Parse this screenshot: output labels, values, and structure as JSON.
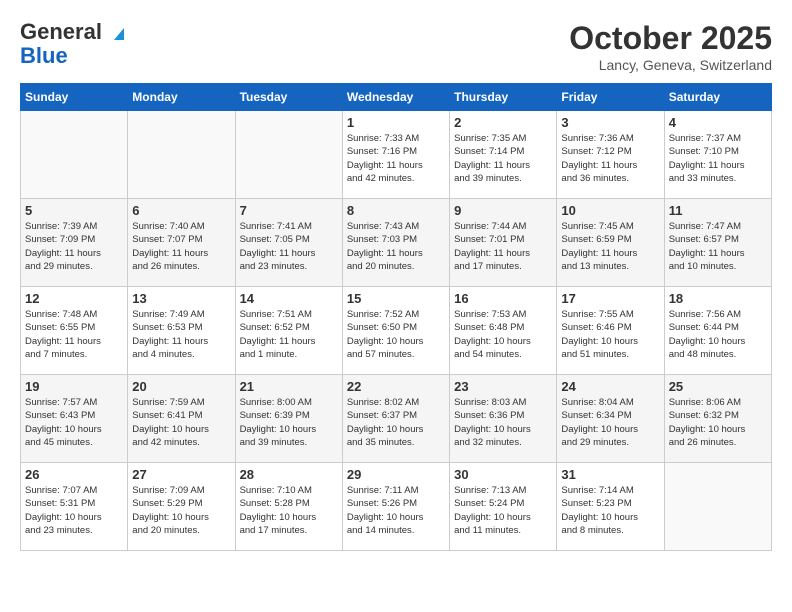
{
  "header": {
    "logo_line1": "General",
    "logo_line2": "Blue",
    "month": "October 2025",
    "location": "Lancy, Geneva, Switzerland"
  },
  "weekdays": [
    "Sunday",
    "Monday",
    "Tuesday",
    "Wednesday",
    "Thursday",
    "Friday",
    "Saturday"
  ],
  "weeks": [
    [
      {
        "day": "",
        "info": ""
      },
      {
        "day": "",
        "info": ""
      },
      {
        "day": "",
        "info": ""
      },
      {
        "day": "1",
        "info": "Sunrise: 7:33 AM\nSunset: 7:16 PM\nDaylight: 11 hours\nand 42 minutes."
      },
      {
        "day": "2",
        "info": "Sunrise: 7:35 AM\nSunset: 7:14 PM\nDaylight: 11 hours\nand 39 minutes."
      },
      {
        "day": "3",
        "info": "Sunrise: 7:36 AM\nSunset: 7:12 PM\nDaylight: 11 hours\nand 36 minutes."
      },
      {
        "day": "4",
        "info": "Sunrise: 7:37 AM\nSunset: 7:10 PM\nDaylight: 11 hours\nand 33 minutes."
      }
    ],
    [
      {
        "day": "5",
        "info": "Sunrise: 7:39 AM\nSunset: 7:09 PM\nDaylight: 11 hours\nand 29 minutes."
      },
      {
        "day": "6",
        "info": "Sunrise: 7:40 AM\nSunset: 7:07 PM\nDaylight: 11 hours\nand 26 minutes."
      },
      {
        "day": "7",
        "info": "Sunrise: 7:41 AM\nSunset: 7:05 PM\nDaylight: 11 hours\nand 23 minutes."
      },
      {
        "day": "8",
        "info": "Sunrise: 7:43 AM\nSunset: 7:03 PM\nDaylight: 11 hours\nand 20 minutes."
      },
      {
        "day": "9",
        "info": "Sunrise: 7:44 AM\nSunset: 7:01 PM\nDaylight: 11 hours\nand 17 minutes."
      },
      {
        "day": "10",
        "info": "Sunrise: 7:45 AM\nSunset: 6:59 PM\nDaylight: 11 hours\nand 13 minutes."
      },
      {
        "day": "11",
        "info": "Sunrise: 7:47 AM\nSunset: 6:57 PM\nDaylight: 11 hours\nand 10 minutes."
      }
    ],
    [
      {
        "day": "12",
        "info": "Sunrise: 7:48 AM\nSunset: 6:55 PM\nDaylight: 11 hours\nand 7 minutes."
      },
      {
        "day": "13",
        "info": "Sunrise: 7:49 AM\nSunset: 6:53 PM\nDaylight: 11 hours\nand 4 minutes."
      },
      {
        "day": "14",
        "info": "Sunrise: 7:51 AM\nSunset: 6:52 PM\nDaylight: 11 hours\nand 1 minute."
      },
      {
        "day": "15",
        "info": "Sunrise: 7:52 AM\nSunset: 6:50 PM\nDaylight: 10 hours\nand 57 minutes."
      },
      {
        "day": "16",
        "info": "Sunrise: 7:53 AM\nSunset: 6:48 PM\nDaylight: 10 hours\nand 54 minutes."
      },
      {
        "day": "17",
        "info": "Sunrise: 7:55 AM\nSunset: 6:46 PM\nDaylight: 10 hours\nand 51 minutes."
      },
      {
        "day": "18",
        "info": "Sunrise: 7:56 AM\nSunset: 6:44 PM\nDaylight: 10 hours\nand 48 minutes."
      }
    ],
    [
      {
        "day": "19",
        "info": "Sunrise: 7:57 AM\nSunset: 6:43 PM\nDaylight: 10 hours\nand 45 minutes."
      },
      {
        "day": "20",
        "info": "Sunrise: 7:59 AM\nSunset: 6:41 PM\nDaylight: 10 hours\nand 42 minutes."
      },
      {
        "day": "21",
        "info": "Sunrise: 8:00 AM\nSunset: 6:39 PM\nDaylight: 10 hours\nand 39 minutes."
      },
      {
        "day": "22",
        "info": "Sunrise: 8:02 AM\nSunset: 6:37 PM\nDaylight: 10 hours\nand 35 minutes."
      },
      {
        "day": "23",
        "info": "Sunrise: 8:03 AM\nSunset: 6:36 PM\nDaylight: 10 hours\nand 32 minutes."
      },
      {
        "day": "24",
        "info": "Sunrise: 8:04 AM\nSunset: 6:34 PM\nDaylight: 10 hours\nand 29 minutes."
      },
      {
        "day": "25",
        "info": "Sunrise: 8:06 AM\nSunset: 6:32 PM\nDaylight: 10 hours\nand 26 minutes."
      }
    ],
    [
      {
        "day": "26",
        "info": "Sunrise: 7:07 AM\nSunset: 5:31 PM\nDaylight: 10 hours\nand 23 minutes."
      },
      {
        "day": "27",
        "info": "Sunrise: 7:09 AM\nSunset: 5:29 PM\nDaylight: 10 hours\nand 20 minutes."
      },
      {
        "day": "28",
        "info": "Sunrise: 7:10 AM\nSunset: 5:28 PM\nDaylight: 10 hours\nand 17 minutes."
      },
      {
        "day": "29",
        "info": "Sunrise: 7:11 AM\nSunset: 5:26 PM\nDaylight: 10 hours\nand 14 minutes."
      },
      {
        "day": "30",
        "info": "Sunrise: 7:13 AM\nSunset: 5:24 PM\nDaylight: 10 hours\nand 11 minutes."
      },
      {
        "day": "31",
        "info": "Sunrise: 7:14 AM\nSunset: 5:23 PM\nDaylight: 10 hours\nand 8 minutes."
      },
      {
        "day": "",
        "info": ""
      }
    ]
  ]
}
